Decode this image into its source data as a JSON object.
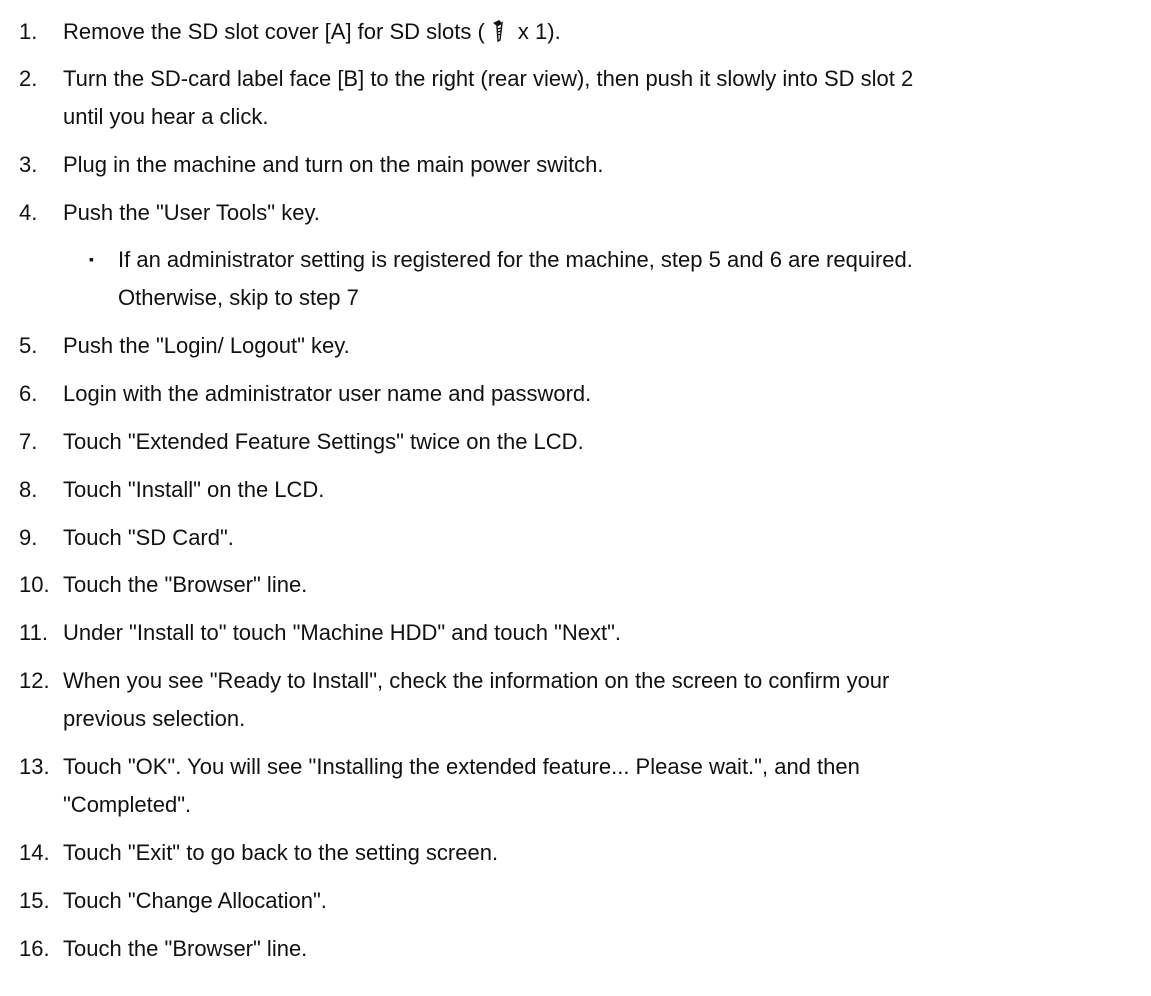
{
  "steps": [
    {
      "num": "1.",
      "lines": [
        "Remove the SD slot cover [A] for SD slots (",
        " x 1)."
      ]
    },
    {
      "num": "2.",
      "lines": [
        "Turn the SD-card label face [B] to the right (rear view), then push it slowly into SD slot 2",
        "until you hear a click."
      ]
    },
    {
      "num": "3.",
      "lines": [
        "Plug in the machine and turn on the main power switch."
      ]
    },
    {
      "num": "4.",
      "lines": [
        "Push the \"User Tools\" key."
      ]
    },
    {
      "num": "5.",
      "lines": [
        "Push the \"Login/ Logout\" key."
      ]
    },
    {
      "num": "6.",
      "lines": [
        "Login with the administrator user name and password."
      ]
    },
    {
      "num": "7.",
      "lines": [
        "Touch \"Extended Feature Settings\" twice on the LCD."
      ]
    },
    {
      "num": "8.",
      "lines": [
        "Touch \"Install\" on the LCD."
      ]
    },
    {
      "num": "9.",
      "lines": [
        "Touch \"SD Card\"."
      ]
    },
    {
      "num": "10.",
      "lines": [
        "Touch the \"Browser\" line."
      ]
    },
    {
      "num": "11.",
      "lines": [
        "Under \"Install to\" touch \"Machine HDD\" and touch \"Next\"."
      ]
    },
    {
      "num": "12.",
      "lines": [
        "When you see \"Ready to Install\", check the information on the screen to confirm your",
        "previous selection."
      ]
    },
    {
      "num": "13.",
      "lines": [
        "Touch \"OK\". You will see \"Installing the extended feature... Please wait.\", and then",
        "\"Completed\"."
      ]
    },
    {
      "num": "14.",
      "lines": [
        "Touch \"Exit\" to go back to the setting screen."
      ]
    },
    {
      "num": "15.",
      "lines": [
        "Touch \"Change Allocation\"."
      ]
    },
    {
      "num": "16.",
      "lines": [
        "Touch the \"Browser\" line."
      ]
    }
  ],
  "note": {
    "bullet": "▪",
    "lines": [
      "If an administrator setting is registered for the machine, step 5 and 6 are required.",
      "Otherwise, skip to step 7"
    ]
  },
  "icons": {
    "screw": "screw-icon"
  }
}
